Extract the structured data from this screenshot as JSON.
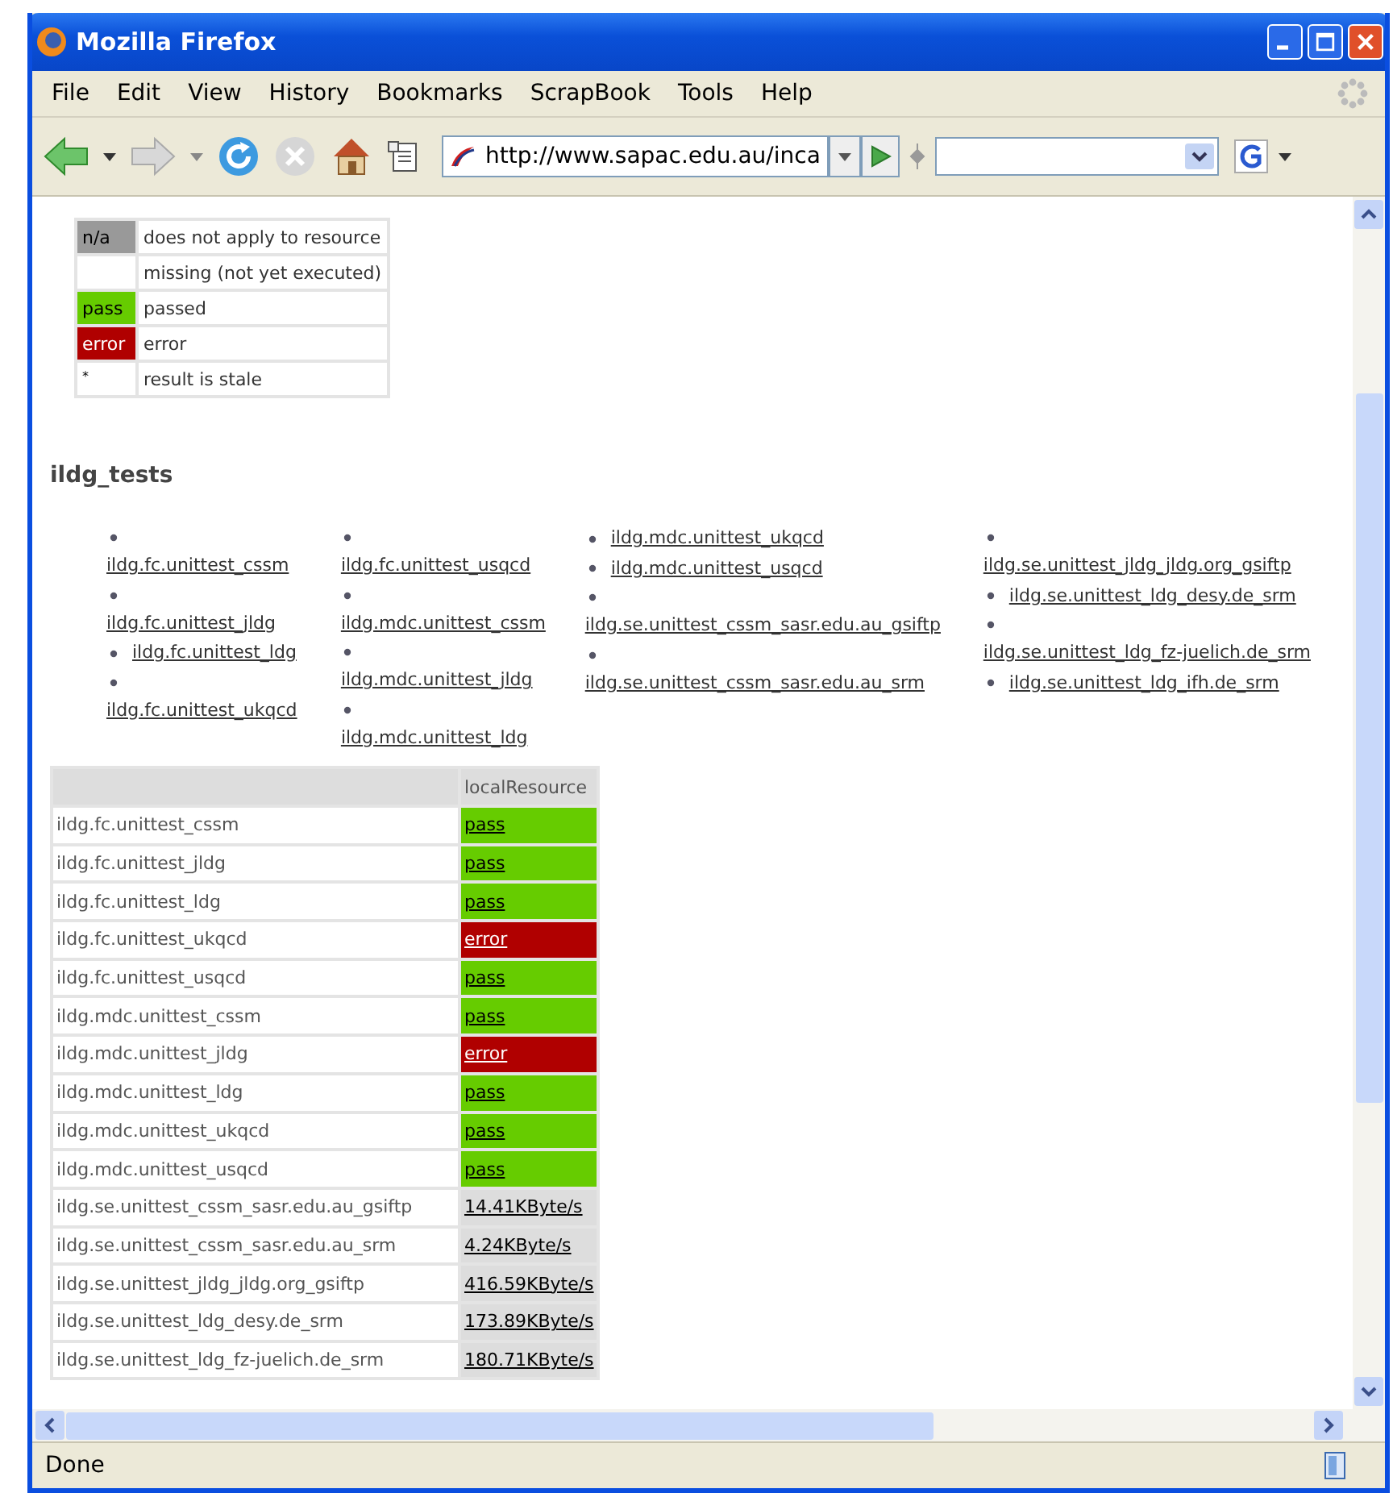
{
  "window": {
    "title": "Mozilla Firefox"
  },
  "menu": [
    {
      "label": "File"
    },
    {
      "label": "Edit"
    },
    {
      "label": "View"
    },
    {
      "label": "History"
    },
    {
      "label": "Bookmarks"
    },
    {
      "label": "ScrapBook"
    },
    {
      "label": "Tools"
    },
    {
      "label": "Help"
    }
  ],
  "address": {
    "value": "http://www.sapac.edu.au/inca"
  },
  "legend": [
    {
      "code": "n/a",
      "description": "does not apply to resource",
      "color": "#999999"
    },
    {
      "description": "missing (not yet executed)",
      "color": "#ffffff"
    },
    {
      "code": "pass",
      "description": "passed",
      "color": "#66cc00"
    },
    {
      "code": "error",
      "description": "error",
      "color": "#b00000"
    },
    {
      "code": "*",
      "description": "result is stale",
      "color": "#ffffff"
    }
  ],
  "heading": "ildg_tests",
  "link_columns": [
    [
      {
        "text": "ildg.fc.unittest_cssm",
        "kind": "wrapped"
      },
      {
        "text": "ildg.fc.unittest_jldg",
        "kind": "wrapped"
      },
      {
        "text": "ildg.fc.unittest_ldg",
        "kind": "inline"
      },
      {
        "text": "ildg.fc.unittest_ukqcd",
        "kind": "wrapped"
      }
    ],
    [
      {
        "text": "ildg.fc.unittest_usqcd",
        "kind": "wrapped"
      },
      {
        "text": "ildg.mdc.unittest_cssm",
        "kind": "wrapped"
      },
      {
        "text": "ildg.mdc.unittest_jldg",
        "kind": "wrapped"
      },
      {
        "text": "ildg.mdc.unittest_ldg",
        "kind": "wrapped"
      }
    ],
    [
      {
        "text": "ildg.mdc.unittest_ukqcd",
        "kind": "inline"
      },
      {
        "text": "ildg.mdc.unittest_usqcd",
        "kind": "inline"
      },
      {
        "text": "ildg.se.unittest_cssm_sasr.edu.au_gsiftp",
        "kind": "wrapped"
      },
      {
        "text": "ildg.se.unittest_cssm_sasr.edu.au_srm",
        "kind": "wrapped"
      }
    ],
    [
      {
        "text": "ildg.se.unittest_jldg_jldg.org_gsiftp",
        "kind": "wrapped"
      },
      {
        "text": "ildg.se.unittest_ldg_desy.de_srm",
        "kind": "inline"
      },
      {
        "text": "ildg.se.unittest_ldg_fz-juelich.de_srm",
        "kind": "wrapped"
      },
      {
        "text": "ildg.se.unittest_ldg_ifh.de_srm",
        "kind": "inline"
      }
    ]
  ],
  "results": {
    "column": "localResource",
    "rows": [
      {
        "test": "ildg.fc.unittest_cssm",
        "result": "pass",
        "color": "#66cc00"
      },
      {
        "test": "ildg.fc.unittest_jldg",
        "result": "pass",
        "color": "#66cc00"
      },
      {
        "test": "ildg.fc.unittest_ldg",
        "result": "pass",
        "color": "#66cc00"
      },
      {
        "test": "ildg.fc.unittest_ukqcd",
        "result": "error",
        "color": "#b00000"
      },
      {
        "test": "ildg.fc.unittest_usqcd",
        "result": "pass",
        "color": "#66cc00"
      },
      {
        "test": "ildg.mdc.unittest_cssm",
        "result": "pass",
        "color": "#66cc00"
      },
      {
        "test": "ildg.mdc.unittest_jldg",
        "result": "error",
        "color": "#b00000"
      },
      {
        "test": "ildg.mdc.unittest_ldg",
        "result": "pass",
        "color": "#66cc00"
      },
      {
        "test": "ildg.mdc.unittest_ukqcd",
        "result": "pass",
        "color": "#66cc00"
      },
      {
        "test": "ildg.mdc.unittest_usqcd",
        "result": "pass",
        "color": "#66cc00"
      },
      {
        "test": "ildg.se.unittest_cssm_sasr.edu.au_gsiftp",
        "result": "14.41KByte/s",
        "color": "#dddddd"
      },
      {
        "test": "ildg.se.unittest_cssm_sasr.edu.au_srm",
        "result": "4.24KByte/s",
        "color": "#dddddd"
      },
      {
        "test": "ildg.se.unittest_jldg_jldg.org_gsiftp",
        "result": "416.59KByte/s",
        "color": "#dddddd"
      },
      {
        "test": "ildg.se.unittest_ldg_desy.de_srm",
        "result": "173.89KByte/s",
        "color": "#dddddd"
      },
      {
        "test": "ildg.se.unittest_ldg_fz-juelich.de_srm",
        "result": "180.71KByte/s",
        "color": "#dddddd"
      }
    ]
  },
  "status_bar": {
    "text": "Done"
  }
}
